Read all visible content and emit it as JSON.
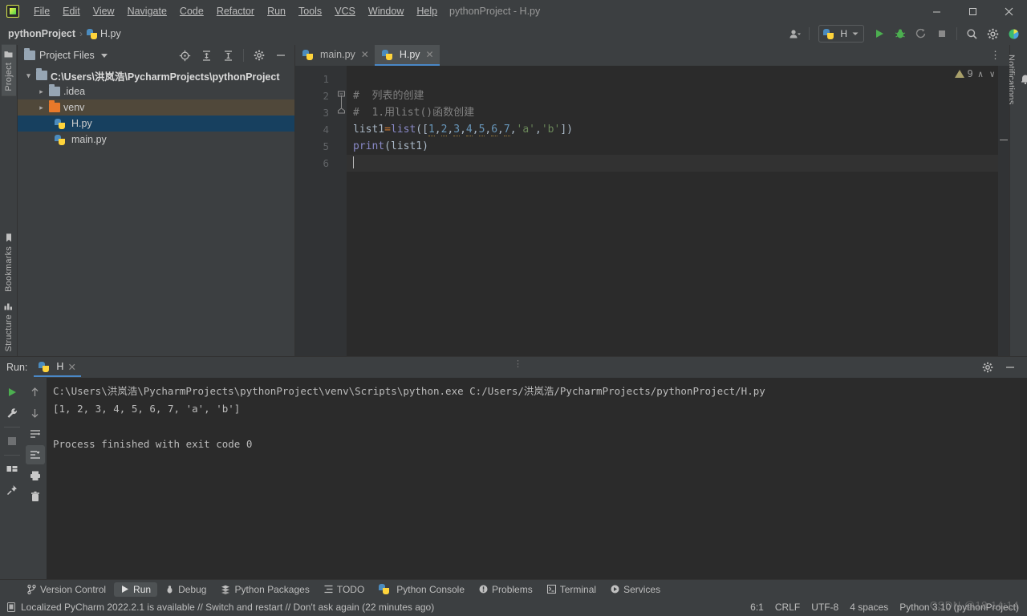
{
  "window": {
    "title": "pythonProject - H.py",
    "minimize_label": "—",
    "maximize_label": "☐",
    "close_label": "✕"
  },
  "menubar": {
    "items": [
      "File",
      "Edit",
      "View",
      "Navigate",
      "Code",
      "Refactor",
      "Run",
      "Tools",
      "VCS",
      "Window",
      "Help"
    ]
  },
  "navbar": {
    "breadcrumb_project": "pythonProject",
    "breadcrumb_sep": "›",
    "breadcrumb_file": "H.py",
    "run_config_name": "H",
    "icons": {
      "user": "user-icon",
      "run": "run-icon",
      "debug": "debug-icon",
      "run_coverage": "run-with-coverage-icon",
      "stop": "stop-icon",
      "search": "search-icon",
      "settings": "settings-gear-icon",
      "updates": "updates-icon"
    }
  },
  "left_strip": {
    "project_tab": "Project",
    "bookmarks_tab": "Bookmarks",
    "structure_tab": "Structure"
  },
  "right_strip": {
    "notifications_tab": "Notifications"
  },
  "project_panel": {
    "title": "Project Files",
    "tree": [
      {
        "label": "C:\\Users\\洪岚浩\\PycharmProjects\\pythonProject",
        "type": "root-folder",
        "expanded": true,
        "depth": 0
      },
      {
        "label": ".idea",
        "type": "folder",
        "expanded": false,
        "depth": 1
      },
      {
        "label": "venv",
        "type": "folder-orange",
        "expanded": false,
        "depth": 1,
        "highlighted": true
      },
      {
        "label": "H.py",
        "type": "python-file",
        "depth": 2,
        "selected": true
      },
      {
        "label": "main.py",
        "type": "python-file",
        "depth": 2
      }
    ],
    "toolbar_icons": [
      "locate-icon",
      "expand-all-icon",
      "collapse-all-icon",
      "settings-gear-icon",
      "hide-icon"
    ]
  },
  "editor": {
    "tabs": [
      {
        "label": "main.py",
        "active": false
      },
      {
        "label": "H.py",
        "active": true
      }
    ],
    "line_numbers": [
      "1",
      "2",
      "3",
      "4",
      "5",
      "6"
    ],
    "lines": [
      {
        "n": "1",
        "text": ""
      },
      {
        "n": "2",
        "text": "#  列表的创建"
      },
      {
        "n": "3",
        "text": "#  1.用list()函数创建"
      },
      {
        "n": "4",
        "text": "list1=list([1,2,3,4,5,6,7,'a','b'])"
      },
      {
        "n": "5",
        "text": "print(list1)"
      },
      {
        "n": "6",
        "text": ""
      }
    ],
    "warning_count": "9",
    "warning_icon": "warning-triangle-icon",
    "up_chevron": "∧",
    "down_chevron": "∨"
  },
  "run_panel": {
    "label": "Run:",
    "tab_name": "H",
    "console_lines": [
      "C:\\Users\\洪岚浩\\PycharmProjects\\pythonProject\\venv\\Scripts\\python.exe C:/Users/洪岚浩/PycharmProjects/pythonProject/H.py",
      "[1, 2, 3, 4, 5, 6, 7, 'a', 'b']",
      "",
      "Process finished with exit code 0"
    ],
    "sidebar_icons": [
      "rerun-icon",
      "wrench-icon",
      "stop-icon",
      "layout-icon",
      "pin-icon",
      "up-arrow-icon",
      "down-arrow-icon",
      "soft-wrap-icon",
      "scroll-to-end-icon",
      "print-icon",
      "trash-icon"
    ],
    "header_icons": [
      "settings-gear-icon",
      "hide-icon"
    ]
  },
  "bottom_tabs": [
    {
      "label": "Version Control",
      "icon": "branch-icon",
      "active": false
    },
    {
      "label": "Run",
      "icon": "run-icon",
      "active": true
    },
    {
      "label": "Debug",
      "icon": "debug-icon",
      "active": false
    },
    {
      "label": "Python Packages",
      "icon": "packages-icon",
      "active": false
    },
    {
      "label": "TODO",
      "icon": "todo-icon",
      "active": false
    },
    {
      "label": "Python Console",
      "icon": "python-icon",
      "active": false
    },
    {
      "label": "Problems",
      "icon": "problems-icon",
      "active": false
    },
    {
      "label": "Terminal",
      "icon": "terminal-icon",
      "active": false
    },
    {
      "label": "Services",
      "icon": "services-icon",
      "active": false
    }
  ],
  "status_bar": {
    "message": "Localized PyCharm 2022.2.1 is available // Switch and restart // Don't ask again (22 minutes ago)",
    "caret_position": "6:1",
    "line_separator": "CRLF",
    "encoding": "UTF-8",
    "indent": "4 spaces",
    "interpreter": "Python 3.10 (pythonProject)",
    "watermark": "CSDN @18:14:14"
  },
  "colors": {
    "background": "#3c3f41",
    "editor_bg": "#2b2b2b",
    "gutter_bg": "#313335",
    "accent_blue": "#4a88c7",
    "selection_blue": "#17405f",
    "venv_orange": "#50483a",
    "run_green": "#4caf50",
    "keyword_orange": "#cc7832",
    "string_green": "#6a8759",
    "number_blue": "#6897bb",
    "comment_gray": "#808080",
    "builtin_purple": "#8888c6"
  }
}
